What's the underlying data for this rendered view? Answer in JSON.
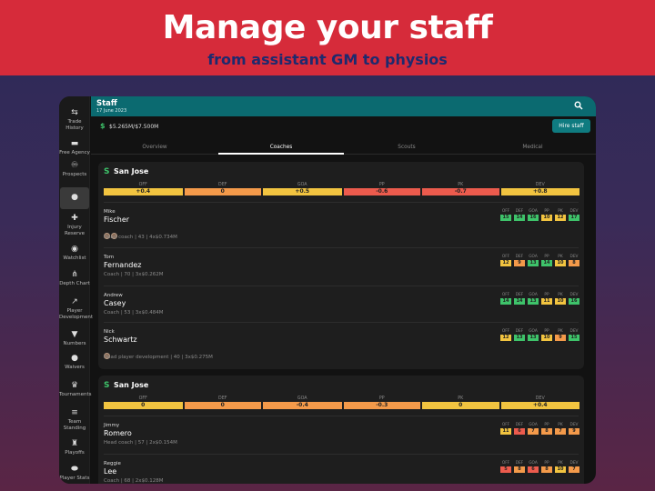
{
  "banner": {
    "title": "Manage your staff",
    "subtitle": "from assistant GM to physios"
  },
  "topbar": {
    "title": "Staff",
    "date": "17 June 2023",
    "search_icon": "search-icon"
  },
  "budget": {
    "icon": "dollar-icon",
    "amount": "$5.265M/$7.500M",
    "hire_label": "Hire staff"
  },
  "sidebar": {
    "items": [
      {
        "label": "Trade History",
        "icon": "trade-icon"
      },
      {
        "label": "Free Agency",
        "icon": "free-agency-icon"
      },
      {
        "label": "Prospects",
        "icon": "binoculars-icon"
      },
      {
        "label": "",
        "icon": "staff-icon"
      },
      {
        "label": "Injury Reserve",
        "icon": "injury-icon"
      },
      {
        "label": "Watchlist",
        "icon": "eye-icon"
      },
      {
        "label": "Depth Chart",
        "icon": "depth-chart-icon"
      },
      {
        "label": "Player Development",
        "icon": "development-icon"
      },
      {
        "label": "Numbers",
        "icon": "jersey-icon"
      },
      {
        "label": "Waivers",
        "icon": "waivers-icon"
      },
      {
        "label": "Tournaments",
        "icon": "trophy-icon"
      },
      {
        "label": "Team Standing",
        "icon": "standing-icon"
      },
      {
        "label": "Playoffs",
        "icon": "playoffs-icon"
      },
      {
        "label": "Player Stats",
        "icon": "puck-icon"
      }
    ]
  },
  "tabs": [
    "Overview",
    "Coaches",
    "Scouts",
    "Medical"
  ],
  "active_tab": "Coaches",
  "colors": {
    "teal": "#0b6a70",
    "banner_red": "#d62b3a",
    "rating_green": "#3ec36a",
    "rating_yellow": "#f2c440",
    "rating_orange": "#f49a4a",
    "rating_red": "#ec5b4d"
  },
  "rating_labels": [
    "OFF",
    "DEF",
    "GOA",
    "PP",
    "PK",
    "DEV"
  ],
  "teams": [
    {
      "name": "San Jose",
      "summary": [
        {
          "label": "OFF",
          "value": "+0.4",
          "color": "#f2c440"
        },
        {
          "label": "DEF",
          "value": "0",
          "color": "#f49a4a"
        },
        {
          "label": "GOA",
          "value": "+0.5",
          "color": "#f2c440"
        },
        {
          "label": "PP",
          "value": "-0.6",
          "color": "#ec5b4d"
        },
        {
          "label": "PK",
          "value": "-0.7",
          "color": "#ec5b4d"
        },
        {
          "label": "DEV",
          "value": "+0.8",
          "color": "#f2c440"
        }
      ],
      "staff": [
        {
          "first": "Mike",
          "last": "Fischer",
          "badges": 2,
          "meta": "Head coach | 43 | 4x$0.734M",
          "ratings": [
            {
              "v": "15",
              "c": "#3ec36a"
            },
            {
              "v": "14",
              "c": "#3ec36a"
            },
            {
              "v": "16",
              "c": "#3ec36a"
            },
            {
              "v": "10",
              "c": "#f2c440"
            },
            {
              "v": "12",
              "c": "#f2c440"
            },
            {
              "v": "17",
              "c": "#3ec36a"
            }
          ]
        },
        {
          "first": "Tom",
          "last": "Fernandez",
          "badges": 0,
          "meta": "Coach | 70 | 3x$0.262M",
          "ratings": [
            {
              "v": "12",
              "c": "#f2c440"
            },
            {
              "v": "9",
              "c": "#f49a4a"
            },
            {
              "v": "13",
              "c": "#3ec36a"
            },
            {
              "v": "14",
              "c": "#3ec36a"
            },
            {
              "v": "10",
              "c": "#f2c440"
            },
            {
              "v": "8",
              "c": "#f49a4a"
            }
          ]
        },
        {
          "first": "Andrew",
          "last": "Casey",
          "badges": 0,
          "meta": "Coach | 53 | 3x$0.484M",
          "ratings": [
            {
              "v": "14",
              "c": "#3ec36a"
            },
            {
              "v": "14",
              "c": "#3ec36a"
            },
            {
              "v": "13",
              "c": "#3ec36a"
            },
            {
              "v": "11",
              "c": "#f2c440"
            },
            {
              "v": "10",
              "c": "#f2c440"
            },
            {
              "v": "16",
              "c": "#3ec36a"
            }
          ]
        },
        {
          "first": "Nick",
          "last": "Schwartz",
          "badges": 1,
          "meta": "Head player development | 40 | 3x$0.275M",
          "ratings": [
            {
              "v": "12",
              "c": "#f2c440"
            },
            {
              "v": "13",
              "c": "#3ec36a"
            },
            {
              "v": "13",
              "c": "#3ec36a"
            },
            {
              "v": "10",
              "c": "#f2c440"
            },
            {
              "v": "9",
              "c": "#f49a4a"
            },
            {
              "v": "15",
              "c": "#3ec36a"
            }
          ]
        }
      ]
    },
    {
      "name": "San Jose",
      "summary": [
        {
          "label": "OFF",
          "value": "0",
          "color": "#f2c440"
        },
        {
          "label": "DEF",
          "value": "0",
          "color": "#f49a4a"
        },
        {
          "label": "GOA",
          "value": "-0.4",
          "color": "#f49a4a"
        },
        {
          "label": "PP",
          "value": "-0.3",
          "color": "#f49a4a"
        },
        {
          "label": "PK",
          "value": "0",
          "color": "#f2c440"
        },
        {
          "label": "DEV",
          "value": "+0.4",
          "color": "#f2c440"
        }
      ],
      "staff": [
        {
          "first": "Jimmy",
          "last": "Romero",
          "badges": 0,
          "meta": "Head coach | 57 | 2x$0.154M",
          "ratings": [
            {
              "v": "11",
              "c": "#f2c440"
            },
            {
              "v": "6",
              "c": "#ec5b4d"
            },
            {
              "v": "7",
              "c": "#f49a4a"
            },
            {
              "v": "8",
              "c": "#f49a4a"
            },
            {
              "v": "7",
              "c": "#f49a4a"
            },
            {
              "v": "9",
              "c": "#f49a4a"
            }
          ]
        },
        {
          "first": "Reggie",
          "last": "Lee",
          "badges": 0,
          "meta": "Coach | 68 | 2x$0.128M",
          "ratings": [
            {
              "v": "5",
              "c": "#ec5b4d"
            },
            {
              "v": "8",
              "c": "#f49a4a"
            },
            {
              "v": "6",
              "c": "#ec5b4d"
            },
            {
              "v": "8",
              "c": "#f49a4a"
            },
            {
              "v": "10",
              "c": "#f2c440"
            },
            {
              "v": "7",
              "c": "#f49a4a"
            }
          ]
        }
      ]
    }
  ]
}
